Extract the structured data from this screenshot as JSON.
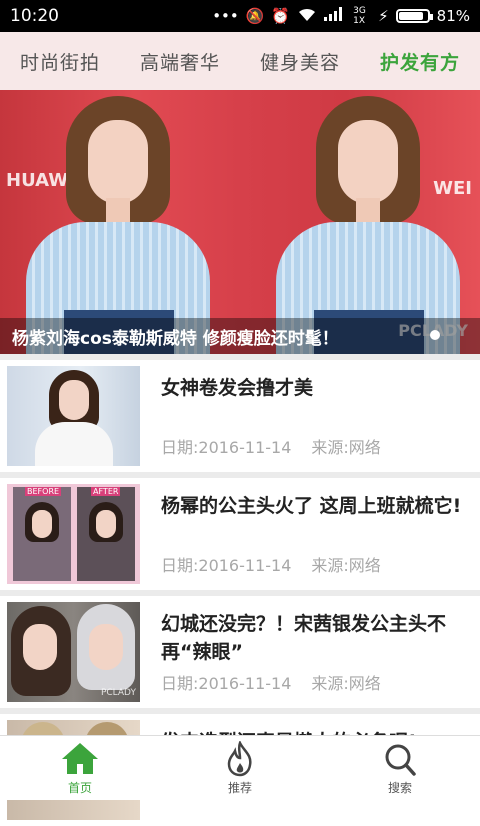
{
  "status": {
    "time": "10:20",
    "network": "3G 1X",
    "battery_pct_label": "81%",
    "battery_level": 0.81
  },
  "tabs": [
    {
      "label": "时尚街拍",
      "active": false
    },
    {
      "label": "高端奢华",
      "active": false
    },
    {
      "label": "健身美容",
      "active": false
    },
    {
      "label": "护发有方",
      "active": true
    }
  ],
  "banner": {
    "caption": "杨紫刘海cos泰勒斯威特 修颜瘦脸还时髦！",
    "watermark": "PCLADY",
    "brand_left": "HUAWEI",
    "brand_right": "WEI"
  },
  "articles": [
    {
      "title": "女神卷发会撸才美",
      "date": "日期:2016-11-14",
      "source": "来源:网络"
    },
    {
      "title": "杨幂的公主头火了 这周上班就梳它!",
      "date": "日期:2016-11-14",
      "source": "来源:网络",
      "thumb_tags": [
        "BEFORE",
        "AFTER"
      ]
    },
    {
      "title": "幻城还没完？！宋茜银发公主头不再“辣眼”",
      "date": "日期:2016-11-14",
      "source": "来源:网络",
      "thumb_watermark": "PCLADY"
    },
    {
      "title": "发夹造型还真是懒人的必备呢!",
      "date": "",
      "source": ""
    }
  ],
  "bottom_nav": [
    {
      "label": "首页",
      "icon": "home-icon",
      "active": true
    },
    {
      "label": "推荐",
      "icon": "flame-icon",
      "active": false
    },
    {
      "label": "搜索",
      "icon": "search-icon",
      "active": false
    }
  ],
  "colors": {
    "accent": "#3ca43c",
    "tab_bar_bg": "#f7e8e8"
  }
}
